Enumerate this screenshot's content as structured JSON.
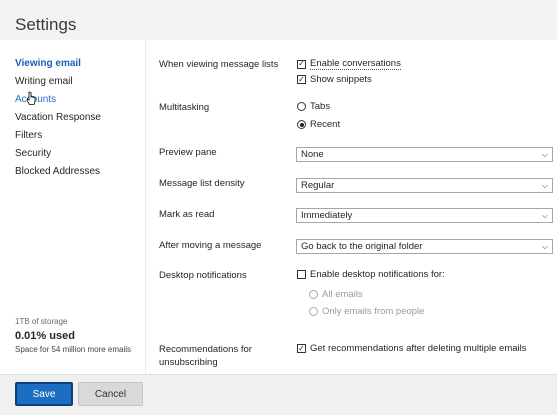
{
  "header": {
    "title": "Settings"
  },
  "sidebar": {
    "items": [
      {
        "label": "Viewing email",
        "active": true
      },
      {
        "label": "Writing email"
      },
      {
        "label": "Accounts"
      },
      {
        "label": "Vacation Response"
      },
      {
        "label": "Filters"
      },
      {
        "label": "Security"
      },
      {
        "label": "Blocked Addresses"
      }
    ],
    "storage": {
      "total": "1TB of storage",
      "used": "0.01% used",
      "note": "Space for 54 million more emails"
    }
  },
  "settings": {
    "message_lists": {
      "label": "When viewing message lists",
      "enable_conversations": {
        "label": "Enable conversations",
        "checked": true
      },
      "show_snippets": {
        "label": "Show snippets",
        "checked": true
      }
    },
    "multitasking": {
      "label": "Multitasking",
      "options": [
        {
          "label": "Tabs",
          "selected": false
        },
        {
          "label": "Recent",
          "selected": true
        }
      ]
    },
    "preview_pane": {
      "label": "Preview pane",
      "value": "None"
    },
    "density": {
      "label": "Message list density",
      "value": "Regular"
    },
    "mark_as_read": {
      "label": "Mark as read",
      "value": "Immediately"
    },
    "after_moving": {
      "label": "After moving a message",
      "value": "Go back to the original folder"
    },
    "desktop_notifications": {
      "label": "Desktop notifications",
      "enable": {
        "label": "Enable desktop notifications for:",
        "checked": false
      },
      "options": [
        {
          "label": "All emails"
        },
        {
          "label": "Only emails from people"
        }
      ]
    },
    "recommendations": {
      "label_line1": "Recommendations for",
      "label_line2": "unsubscribing",
      "option": {
        "label": "Get recommendations after deleting multiple emails",
        "checked": true
      }
    }
  },
  "footer": {
    "save_label": "Save",
    "cancel_label": "Cancel"
  },
  "colors": {
    "accent": "#1b6ec2",
    "active_nav": "#1a5fb4"
  },
  "icons": {
    "check": "✓",
    "chevron": "chevron-down-icon"
  }
}
